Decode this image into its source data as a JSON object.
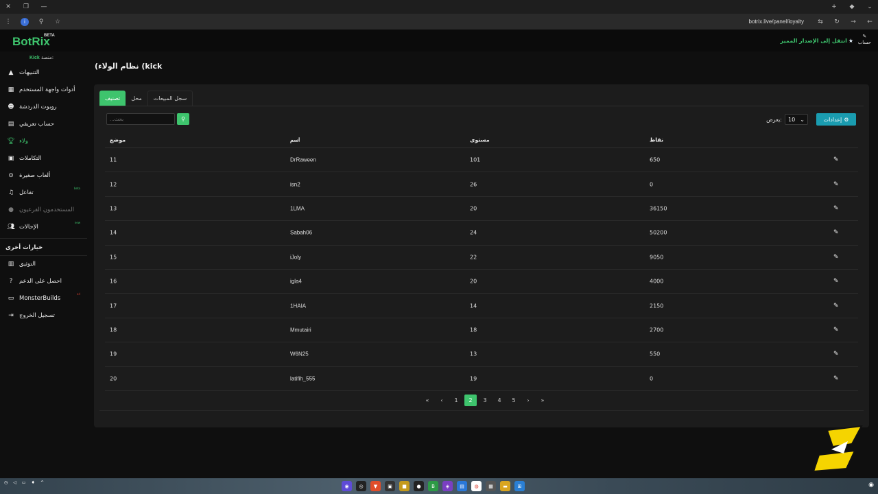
{
  "browser": {
    "url": "botrix.live/panel/loyalty",
    "tab_icons": [
      "close-icon",
      "restore-icon",
      "minimize-icon"
    ],
    "right_icons": [
      "plus-icon",
      "extension-icon",
      "chevron-down-icon"
    ]
  },
  "topbar": {
    "brand": "BotRix",
    "beta": "BETA",
    "upgrade": "انتقل إلى الإصدار المميز",
    "account": "حساب"
  },
  "sidebar": {
    "platform_label": "منصة:",
    "platform_value": "Kick",
    "items": [
      {
        "label": "التنبيهات",
        "icon": "warning-icon"
      },
      {
        "label": "أدوات واجهة المستخدم",
        "icon": "widgets-icon"
      },
      {
        "label": "روبوت الدردشة",
        "icon": "robot-icon"
      },
      {
        "label": "حساب تعريفي",
        "icon": "id-card-icon"
      },
      {
        "label": "ولاء",
        "icon": "trophy-icon"
      },
      {
        "label": "التكاملات",
        "icon": "integrations-icon"
      },
      {
        "label": "ألعاب صغيرة",
        "icon": "gamepad-icon"
      },
      {
        "label": "تفاعل",
        "icon": "music-icon",
        "badge": "beta"
      },
      {
        "label": "المستخدمون الفرعيون",
        "icon": "user-icon"
      },
      {
        "label": "الإحالات",
        "icon": "users-icon",
        "badge": "new"
      }
    ],
    "other_header": "خيارات أخرى",
    "other_items": [
      {
        "label": "التوثيق",
        "icon": "book-icon"
      },
      {
        "label": "احصل على الدعم",
        "icon": "help-icon"
      },
      {
        "label": "MonsterBuilds",
        "icon": "laptop-icon",
        "badge": "ad"
      },
      {
        "label": "تسجيل الخروج",
        "icon": "logout-icon"
      }
    ]
  },
  "page": {
    "title": "(نظام الولاء (kick"
  },
  "tabs": [
    {
      "label": "تصنيف"
    },
    {
      "label": "محل"
    },
    {
      "label": "سجل المبيعات"
    }
  ],
  "search": {
    "placeholder": "...بحث"
  },
  "show": {
    "label": "يعرض:",
    "value": "10"
  },
  "settings_label": "إعدادات",
  "table": {
    "headers": {
      "position": "موضع",
      "name": "اسم",
      "level": "مستوى",
      "points": "نقاط"
    },
    "rows": [
      {
        "position": "11",
        "name": "DrRaween",
        "level": "101",
        "points": "650"
      },
      {
        "position": "12",
        "name": "isn2",
        "level": "26",
        "points": "0"
      },
      {
        "position": "13",
        "name": "1LMA",
        "level": "20",
        "points": "36150"
      },
      {
        "position": "14",
        "name": "Sabah06",
        "level": "24",
        "points": "50200"
      },
      {
        "position": "15",
        "name": "iJoly",
        "level": "22",
        "points": "9050"
      },
      {
        "position": "16",
        "name": "igla4",
        "level": "20",
        "points": "4000"
      },
      {
        "position": "17",
        "name": "1HAIA",
        "level": "14",
        "points": "2150"
      },
      {
        "position": "18",
        "name": "Mmutairi",
        "level": "18",
        "points": "2700"
      },
      {
        "position": "19",
        "name": "W6N25",
        "level": "13",
        "points": "550"
      },
      {
        "position": "20",
        "name": "latifih_555",
        "level": "19",
        "points": "0"
      }
    ]
  },
  "pagination": {
    "pages": [
      "1",
      "2",
      "3",
      "4",
      "5"
    ],
    "current": "2"
  },
  "colors": {
    "accent": "#3ec46d",
    "settings": "#1a9cb0",
    "background": "#0f0f0f",
    "card": "#1c1c1c"
  }
}
